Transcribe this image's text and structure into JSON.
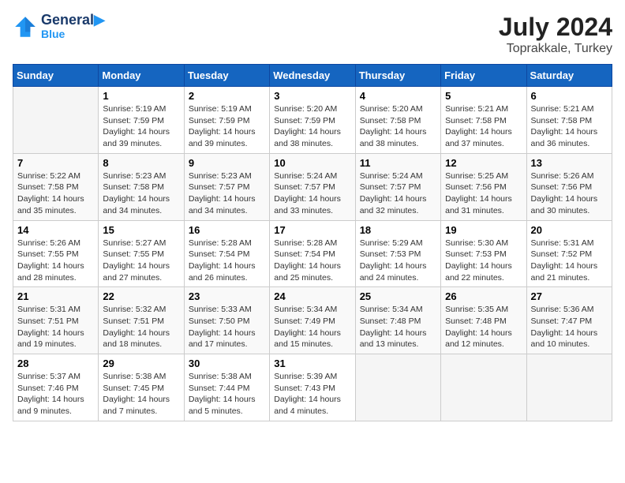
{
  "logo": {
    "line1": "General",
    "line2": "Blue"
  },
  "title": "July 2024",
  "subtitle": "Toprakkale, Turkey",
  "days_of_week": [
    "Sunday",
    "Monday",
    "Tuesday",
    "Wednesday",
    "Thursday",
    "Friday",
    "Saturday"
  ],
  "weeks": [
    [
      {
        "day": "",
        "info": ""
      },
      {
        "day": "1",
        "info": "Sunrise: 5:19 AM\nSunset: 7:59 PM\nDaylight: 14 hours\nand 39 minutes."
      },
      {
        "day": "2",
        "info": "Sunrise: 5:19 AM\nSunset: 7:59 PM\nDaylight: 14 hours\nand 39 minutes."
      },
      {
        "day": "3",
        "info": "Sunrise: 5:20 AM\nSunset: 7:59 PM\nDaylight: 14 hours\nand 38 minutes."
      },
      {
        "day": "4",
        "info": "Sunrise: 5:20 AM\nSunset: 7:58 PM\nDaylight: 14 hours\nand 38 minutes."
      },
      {
        "day": "5",
        "info": "Sunrise: 5:21 AM\nSunset: 7:58 PM\nDaylight: 14 hours\nand 37 minutes."
      },
      {
        "day": "6",
        "info": "Sunrise: 5:21 AM\nSunset: 7:58 PM\nDaylight: 14 hours\nand 36 minutes."
      }
    ],
    [
      {
        "day": "7",
        "info": "Sunrise: 5:22 AM\nSunset: 7:58 PM\nDaylight: 14 hours\nand 35 minutes."
      },
      {
        "day": "8",
        "info": "Sunrise: 5:23 AM\nSunset: 7:58 PM\nDaylight: 14 hours\nand 34 minutes."
      },
      {
        "day": "9",
        "info": "Sunrise: 5:23 AM\nSunset: 7:57 PM\nDaylight: 14 hours\nand 34 minutes."
      },
      {
        "day": "10",
        "info": "Sunrise: 5:24 AM\nSunset: 7:57 PM\nDaylight: 14 hours\nand 33 minutes."
      },
      {
        "day": "11",
        "info": "Sunrise: 5:24 AM\nSunset: 7:57 PM\nDaylight: 14 hours\nand 32 minutes."
      },
      {
        "day": "12",
        "info": "Sunrise: 5:25 AM\nSunset: 7:56 PM\nDaylight: 14 hours\nand 31 minutes."
      },
      {
        "day": "13",
        "info": "Sunrise: 5:26 AM\nSunset: 7:56 PM\nDaylight: 14 hours\nand 30 minutes."
      }
    ],
    [
      {
        "day": "14",
        "info": "Sunrise: 5:26 AM\nSunset: 7:55 PM\nDaylight: 14 hours\nand 28 minutes."
      },
      {
        "day": "15",
        "info": "Sunrise: 5:27 AM\nSunset: 7:55 PM\nDaylight: 14 hours\nand 27 minutes."
      },
      {
        "day": "16",
        "info": "Sunrise: 5:28 AM\nSunset: 7:54 PM\nDaylight: 14 hours\nand 26 minutes."
      },
      {
        "day": "17",
        "info": "Sunrise: 5:28 AM\nSunset: 7:54 PM\nDaylight: 14 hours\nand 25 minutes."
      },
      {
        "day": "18",
        "info": "Sunrise: 5:29 AM\nSunset: 7:53 PM\nDaylight: 14 hours\nand 24 minutes."
      },
      {
        "day": "19",
        "info": "Sunrise: 5:30 AM\nSunset: 7:53 PM\nDaylight: 14 hours\nand 22 minutes."
      },
      {
        "day": "20",
        "info": "Sunrise: 5:31 AM\nSunset: 7:52 PM\nDaylight: 14 hours\nand 21 minutes."
      }
    ],
    [
      {
        "day": "21",
        "info": "Sunrise: 5:31 AM\nSunset: 7:51 PM\nDaylight: 14 hours\nand 19 minutes."
      },
      {
        "day": "22",
        "info": "Sunrise: 5:32 AM\nSunset: 7:51 PM\nDaylight: 14 hours\nand 18 minutes."
      },
      {
        "day": "23",
        "info": "Sunrise: 5:33 AM\nSunset: 7:50 PM\nDaylight: 14 hours\nand 17 minutes."
      },
      {
        "day": "24",
        "info": "Sunrise: 5:34 AM\nSunset: 7:49 PM\nDaylight: 14 hours\nand 15 minutes."
      },
      {
        "day": "25",
        "info": "Sunrise: 5:34 AM\nSunset: 7:48 PM\nDaylight: 14 hours\nand 13 minutes."
      },
      {
        "day": "26",
        "info": "Sunrise: 5:35 AM\nSunset: 7:48 PM\nDaylight: 14 hours\nand 12 minutes."
      },
      {
        "day": "27",
        "info": "Sunrise: 5:36 AM\nSunset: 7:47 PM\nDaylight: 14 hours\nand 10 minutes."
      }
    ],
    [
      {
        "day": "28",
        "info": "Sunrise: 5:37 AM\nSunset: 7:46 PM\nDaylight: 14 hours\nand 9 minutes."
      },
      {
        "day": "29",
        "info": "Sunrise: 5:38 AM\nSunset: 7:45 PM\nDaylight: 14 hours\nand 7 minutes."
      },
      {
        "day": "30",
        "info": "Sunrise: 5:38 AM\nSunset: 7:44 PM\nDaylight: 14 hours\nand 5 minutes."
      },
      {
        "day": "31",
        "info": "Sunrise: 5:39 AM\nSunset: 7:43 PM\nDaylight: 14 hours\nand 4 minutes."
      },
      {
        "day": "",
        "info": ""
      },
      {
        "day": "",
        "info": ""
      },
      {
        "day": "",
        "info": ""
      }
    ]
  ]
}
